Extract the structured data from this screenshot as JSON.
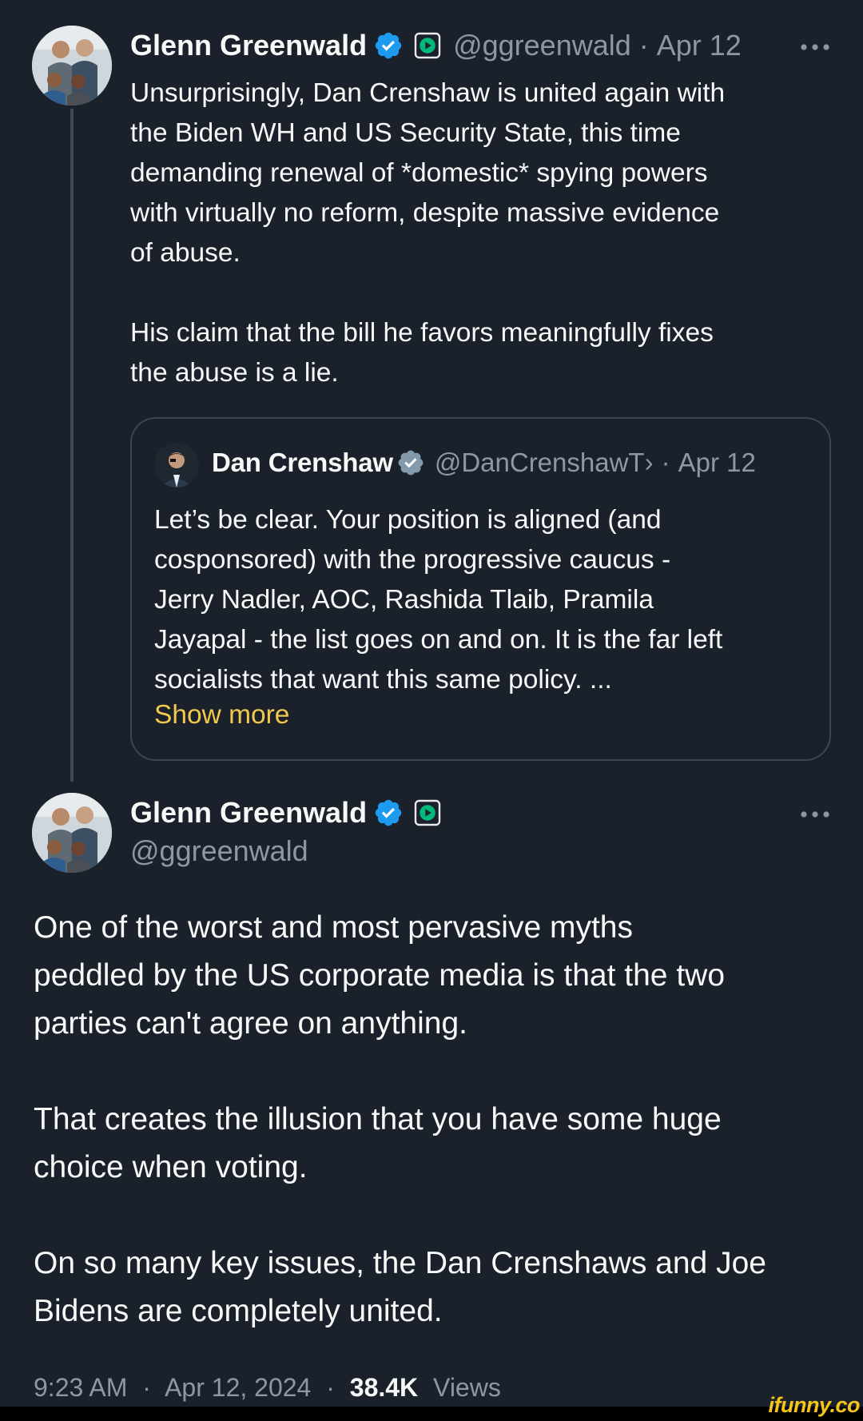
{
  "colors": {
    "background": "#1a212a",
    "text_primary": "#f7f9f9",
    "text_secondary": "#8b98a5",
    "verified_blue": "#1d9bf0",
    "label_green": "#00ba7c",
    "show_more": "#f2c94c",
    "watermark": "#f5c518"
  },
  "parent_tweet": {
    "avatar_icon": "avatar-photo",
    "display_name": "Glenn Greenwald",
    "verified_icon": "verified-badge-icon",
    "label_icon": "play-badge-icon",
    "handle": "@ggreenwald",
    "separator": "·",
    "date": "Apr 12",
    "more_icon": "more-dots-icon",
    "text": "Unsurprisingly, Dan Crenshaw is united again with\nthe Biden WH and US Security State, this time\ndemanding renewal of *domestic* spying powers\nwith virtually no reform, despite massive evidence\nof abuse.\n\nHis claim that the bill he favors meaningfully fixes\nthe abuse is a lie.",
    "quote": {
      "avatar_icon": "avatar-photo",
      "display_name": "Dan Crenshaw",
      "verified_icon": "verified-gray-badge-icon",
      "handle": "@DanCrenshawT›",
      "separator": "·",
      "date": "Apr 12",
      "text": "Let’s be clear. Your position is aligned (and\ncosponsored) with the progressive caucus -\nJerry Nadler, AOC, Rashida Tlaib, Pramila\nJayapal - the list goes on and on. It is the far left\nsocialists that want this same policy. ...",
      "show_more": "Show more"
    }
  },
  "main_tweet": {
    "avatar_icon": "avatar-photo",
    "display_name": "Glenn Greenwald",
    "verified_icon": "verified-badge-icon",
    "label_icon": "play-badge-icon",
    "handle": "@ggreenwald",
    "more_icon": "more-dots-icon",
    "text": "One of the worst and most pervasive myths\npeddled by the US corporate media is that the two\nparties can't agree on anything.\n\nThat creates the illusion that you have some huge\nchoice when voting.\n\nOn so many key issues, the Dan Crenshaws and Joe\nBidens are completely united.",
    "time": "9:23 AM",
    "separator": "·",
    "full_date": "Apr 12, 2024",
    "views_count": "38.4K",
    "views_label": "Views"
  },
  "watermark": "ifunny.co"
}
